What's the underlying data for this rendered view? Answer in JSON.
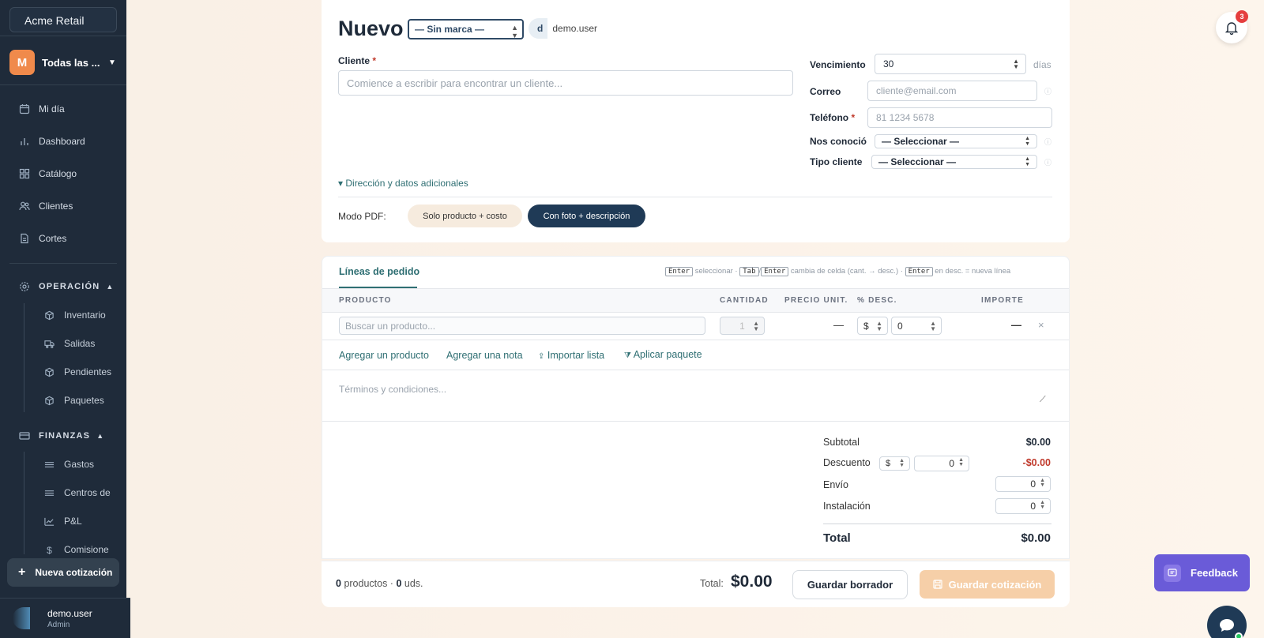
{
  "sidebar": {
    "org": "Acme Retail",
    "store": {
      "avatar": "M",
      "name": "Todas las ..."
    },
    "nav": [
      {
        "label": "Mi día",
        "icon": "calendar-icon"
      },
      {
        "label": "Dashboard",
        "icon": "bar-chart-icon"
      },
      {
        "label": "Catálogo",
        "icon": "grid-icon"
      },
      {
        "label": "Clientes",
        "icon": "users-icon"
      },
      {
        "label": "Cortes",
        "icon": "document-icon"
      }
    ],
    "sections": [
      {
        "label": "OPERACIÓN",
        "icon": "gear-icon",
        "items": [
          {
            "label": "Inventario",
            "icon": "box-icon"
          },
          {
            "label": "Salidas",
            "icon": "truck-icon"
          },
          {
            "label": "Pendientes",
            "icon": "box-icon"
          },
          {
            "label": "Paquetes",
            "icon": "box-icon"
          }
        ]
      },
      {
        "label": "FINANZAS",
        "icon": "credit-card-icon",
        "items": [
          {
            "label": "Gastos",
            "icon": "list-icon"
          },
          {
            "label": "Centros de",
            "icon": "list-icon"
          },
          {
            "label": "P&L",
            "icon": "trend-icon"
          },
          {
            "label": "Comisione",
            "icon": "dollar-icon"
          }
        ]
      }
    ],
    "new_quote": "Nueva cotización",
    "user": {
      "name": "demo.user",
      "role": "Admin"
    }
  },
  "header": {
    "title": "Nuevo",
    "brand_select": "— Sin marca —",
    "user_chip_initial": "d",
    "user_chip_name": "demo.user"
  },
  "form": {
    "cliente_label": "Cliente",
    "required_mark": "*",
    "cliente_placeholder": "Comience a escribir para encontrar un cliente...",
    "vencimiento_label": "Vencimiento",
    "vencimiento_value": "30",
    "dias": "días",
    "correo_label": "Correo",
    "correo_placeholder": "cliente@email.com",
    "telefono_label": "Teléfono",
    "telefono_placeholder": "81 1234 5678",
    "nos_conocio_label": "Nos conoció",
    "tipo_cliente_label": "Tipo cliente",
    "select_placeholder": "— Seleccionar —",
    "direccion_link": "▾ Dirección y datos adicionales",
    "pdf_mode_label": "Modo PDF:",
    "pdf_option_1": "Solo producto + costo",
    "pdf_option_2": "Con foto + descripción"
  },
  "lines": {
    "tab": "Líneas de pedido",
    "hint_enter": "Enter",
    "hint_select": "seleccionar ·",
    "hint_tab": "Tab",
    "hint_slash": "/",
    "hint_enter2": "Enter",
    "hint_change": "cambia de celda (cant. → desc.) ·",
    "hint_enter3": "Enter",
    "hint_newline": "en desc. = nueva línea",
    "columns": [
      "PRODUCTO",
      "CANTIDAD",
      "PRECIO UNIT.",
      "% DESC.",
      "IMPORTE"
    ],
    "product_placeholder": "Buscar un producto...",
    "qty": "1",
    "price": "—",
    "disc_type": "$",
    "disc_value": "0",
    "amount": "—",
    "remove": "×",
    "add_product": "Agregar un producto",
    "add_note": "Agregar una nota",
    "import_list": "Importar lista",
    "apply_package": "Aplicar paquete",
    "terms_placeholder": "Términos y condiciones..."
  },
  "totals": {
    "subtotal_label": "Subtotal",
    "subtotal_value": "$0.00",
    "descuento_label": "Descuento",
    "descuento_type": "$",
    "descuento_input": "0",
    "descuento_value": "-$0.00",
    "envio_label": "Envío",
    "envio_input": "0",
    "instalacion_label": "Instalación",
    "instalacion_input": "0",
    "total_label": "Total",
    "total_value": "$0.00"
  },
  "footer": {
    "products_count": "0",
    "products_word": "productos ·",
    "units_count": "0",
    "units_word": "uds.",
    "total_label": "Total:",
    "total_value": "$0.00",
    "draft_button": "Guardar borrador",
    "save_button": "Guardar cotización"
  },
  "notifications": {
    "count": "3"
  },
  "feedback": "Feedback"
}
